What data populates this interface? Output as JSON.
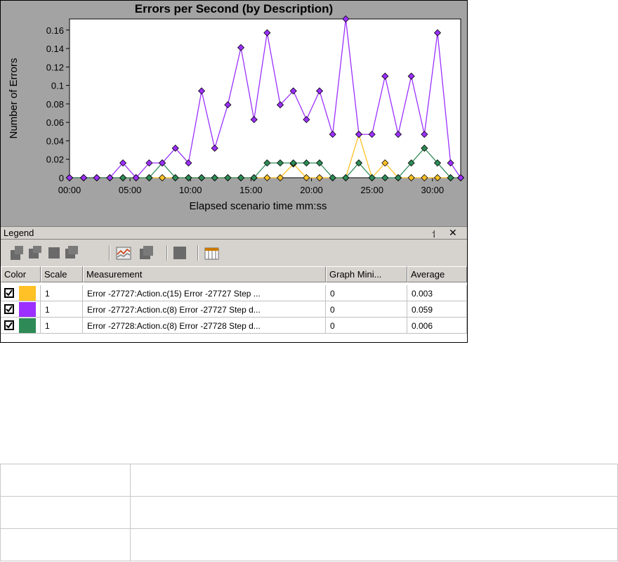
{
  "window": {
    "title": "Errors per Second (by Description)"
  },
  "chart_data": {
    "type": "line",
    "title": "Errors per Second (by Description)",
    "xlabel": "Elapsed scenario time mm:ss",
    "ylabel": "Number of Errors",
    "xlim": [
      "00:00",
      "32:20"
    ],
    "ylim": [
      0,
      0.172
    ],
    "x_tick_labels": [
      "00:00",
      "05:00",
      "10:00",
      "15:00",
      "20:00",
      "25:00",
      "30:00"
    ],
    "y_tick_labels": [
      "0",
      "0.02",
      "0.04",
      "0.06",
      "0.08",
      "0.1",
      "0.12",
      "0.14",
      "0.16"
    ],
    "grid": false,
    "x": [
      "00:00",
      "01:10",
      "02:15",
      "03:20",
      "04:25",
      "05:30",
      "06:35",
      "07:40",
      "08:45",
      "09:50",
      "10:55",
      "12:00",
      "13:05",
      "14:10",
      "15:15",
      "16:20",
      "17:25",
      "18:30",
      "19:35",
      "20:40",
      "21:45",
      "22:50",
      "23:55",
      "25:00",
      "26:05",
      "27:10",
      "28:15",
      "29:20",
      "30:25",
      "31:30",
      "32:20"
    ],
    "series": [
      {
        "color": "#ffc125",
        "values": [
          0,
          0,
          0,
          0,
          0,
          0,
          0,
          0,
          0,
          0,
          0,
          0,
          0,
          0,
          0,
          0,
          0,
          0.015,
          0,
          0,
          0,
          0,
          0.047,
          0,
          0.016,
          0,
          0,
          0,
          0,
          0,
          0
        ]
      },
      {
        "color": "#9b30ff",
        "values": [
          0,
          0,
          0,
          0,
          0.016,
          0,
          0.016,
          0.016,
          0.032,
          0.016,
          0.094,
          0.032,
          0.079,
          0.141,
          0.063,
          0.157,
          0.079,
          0.094,
          0.063,
          0.094,
          0.047,
          0.172,
          0.047,
          0.047,
          0.11,
          0.047,
          0.11,
          0.047,
          0.157,
          0.016,
          0
        ]
      },
      {
        "color": "#2e8b57",
        "values": [
          0,
          0,
          0,
          0,
          0,
          0,
          0,
          0.016,
          0,
          0,
          0,
          0,
          0,
          0,
          0,
          0.016,
          0.016,
          0.016,
          0.016,
          0.016,
          0,
          0,
          0.016,
          0,
          0,
          0,
          0.016,
          0.032,
          0.016,
          0,
          0
        ]
      }
    ]
  },
  "legend": {
    "title": "Legend",
    "pin_icon": "pin-icon",
    "close_icon": "close-icon",
    "toolbar_icons": [
      "show-all-icon",
      "hide-all-icon",
      "show-selected-icon",
      "hide-selected-icon",
      "configure-icon",
      "animate-icon",
      "auto-correlate-icon",
      "legend-columns-icon"
    ],
    "columns": [
      "Color",
      "Scale",
      "Measurement",
      "Graph Mini...",
      "Average"
    ],
    "rows": [
      {
        "checked": true,
        "color": "#ffc125",
        "scale": "1",
        "measurement": "Error -27727:Action.c(15) Error -27727 Step ...",
        "graph_min": "0",
        "average": "0.003"
      },
      {
        "checked": true,
        "color": "#9b30ff",
        "scale": "1",
        "measurement": "Error -27727:Action.c(8) Error -27727 Step d...",
        "graph_min": "0",
        "average": "0.059"
      },
      {
        "checked": true,
        "color": "#2e8b57",
        "scale": "1",
        "measurement": "Error -27728:Action.c(8) Error -27728 Step d...",
        "graph_min": "0",
        "average": "0.006"
      }
    ]
  }
}
